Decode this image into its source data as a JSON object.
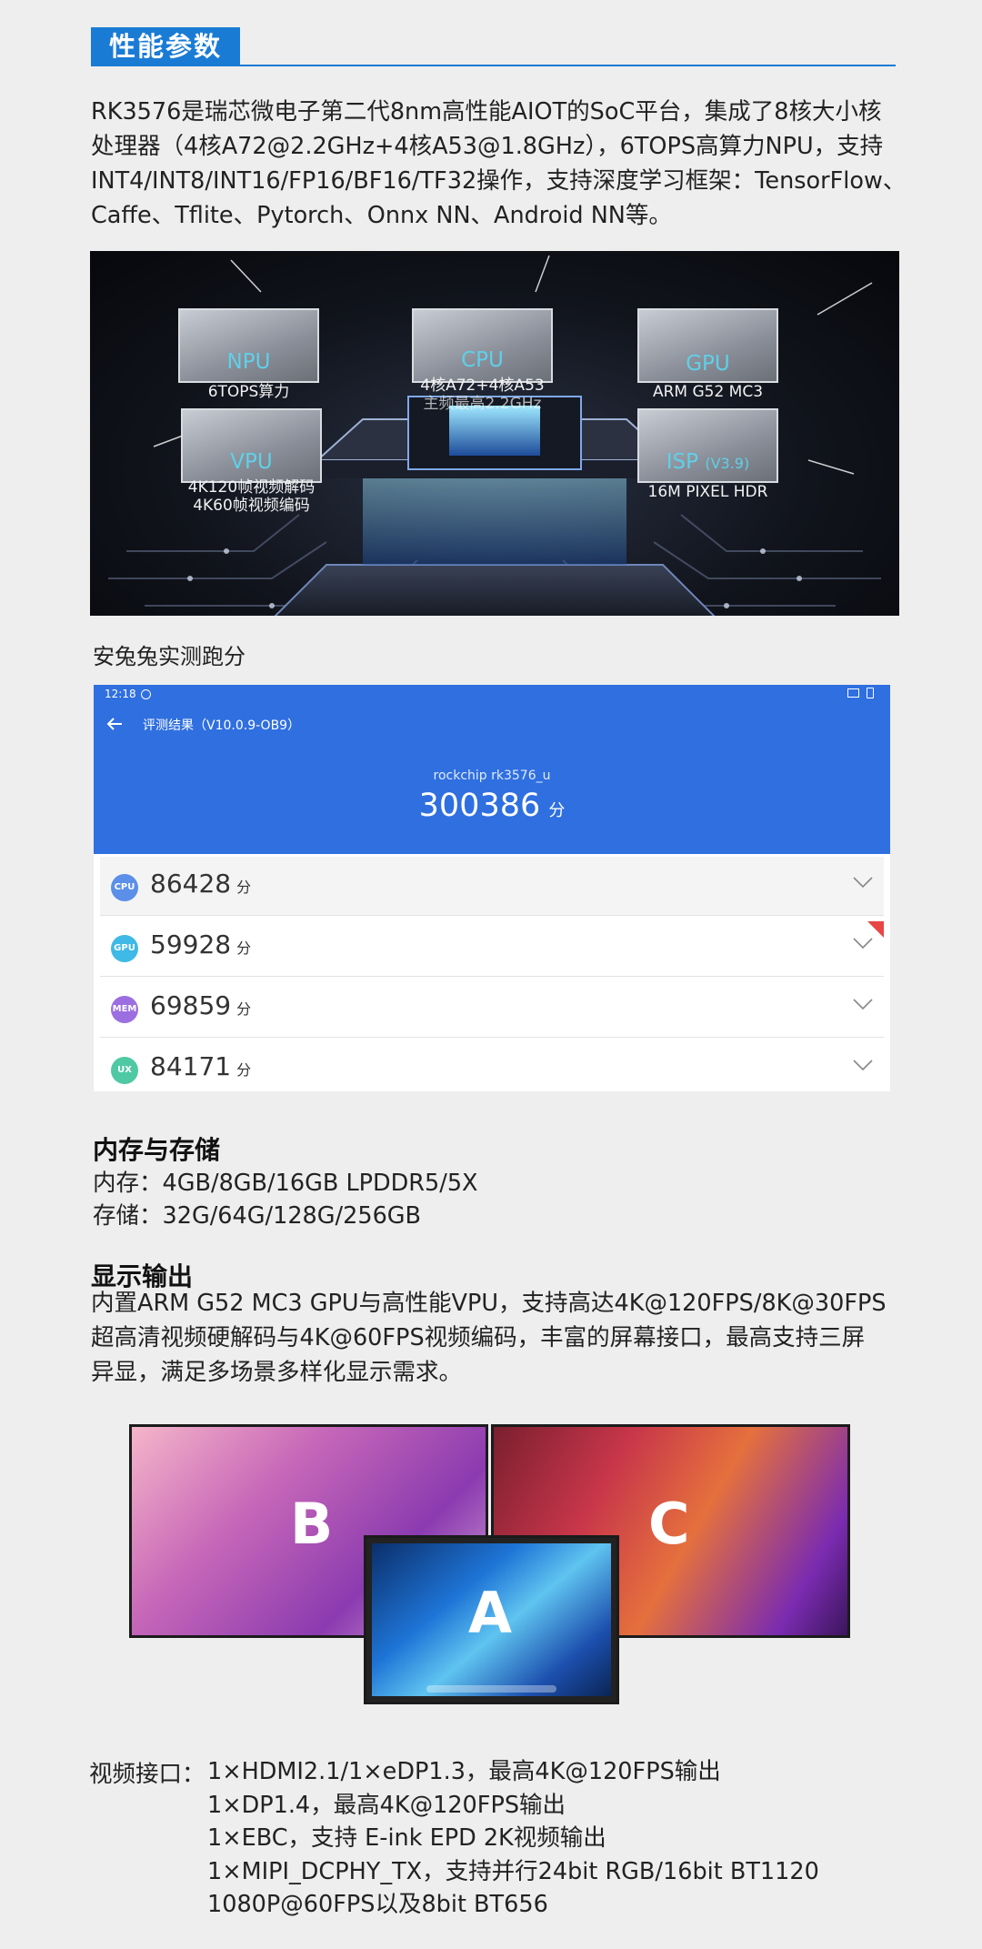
{
  "section_title": "性能参数",
  "intro": {
    "lines": [
      "RK3576是瑞芯微电子第二代8nm高性能AIOT的SoC平台，集成了8核大小核",
      "处理器（4核A72@2.2GHz+4核A53@1.8GHz），6TOPS高算力NPU，支持",
      "INT4/INT8/INT16/FP16/BF16/TF32操作，支持深度学习框架：TensorFlow、",
      "Caffe、Tflite、Pytorch、Onnx NN、Android NN等。"
    ]
  },
  "chip_image": {
    "npu": {
      "title": "NPU",
      "sub": "6TOPS算力"
    },
    "cpu": {
      "title": "CPU",
      "sub1": "4核A72+4核A53",
      "sub2": "主频最高2.2GHz"
    },
    "gpu": {
      "title": "GPU",
      "sub": "ARM G52 MC3"
    },
    "vpu": {
      "title": "VPU",
      "sub1": "4K120帧视频解码",
      "sub2": "4K60帧视频编码"
    },
    "isp": {
      "title": "ISP",
      "version": "(V3.9)",
      "sub": "16M PIXEL HDR"
    }
  },
  "antutu_caption": "安兔兔实测跑分",
  "antutu": {
    "time": "12:18",
    "header_title": "评测结果（V10.0.9-OB9）",
    "device": "rockchip rk3576_u",
    "total": "300386",
    "unit": "分",
    "rows": [
      {
        "badge": "CPU",
        "score": "86428",
        "color": "#5b8fe8"
      },
      {
        "badge": "GPU",
        "score": "59928",
        "color": "#3fb9e6"
      },
      {
        "badge": "MEM",
        "score": "69859",
        "color": "#9b6fe0"
      },
      {
        "badge": "UX",
        "score": "84171",
        "color": "#4fc9a3"
      }
    ]
  },
  "memory": {
    "heading": "内存与存储",
    "ram": "内存：4GB/8GB/16GB LPDDR5/5X",
    "storage": "存储：32G/64G/128G/256GB"
  },
  "display": {
    "heading": "显示输出",
    "lines": [
      "内置ARM G52 MC3 GPU与高性能VPU，支持高达4K@120FPS/8K@30FPS",
      "超高清视频硬解码与4K@60FPS视频编码，丰富的屏幕接口，最高支持三屏",
      "异显，满足多场景多样化显示需求。"
    ],
    "screens": {
      "a": "A",
      "b": "B",
      "c": "C"
    }
  },
  "video": {
    "label": "视频接口：",
    "lines": [
      "1×HDMI2.1/1×eDP1.3，最高4K@120FPS输出",
      "1×DP1.4，最高4K@120FPS输出",
      "1×EBC，支持 E-ink EPD 2K视频输出",
      "1×MIPI_DCPHY_TX，支持并行24bit RGB/16bit BT1120",
      "1080P@60FPS以及8bit BT656"
    ]
  }
}
